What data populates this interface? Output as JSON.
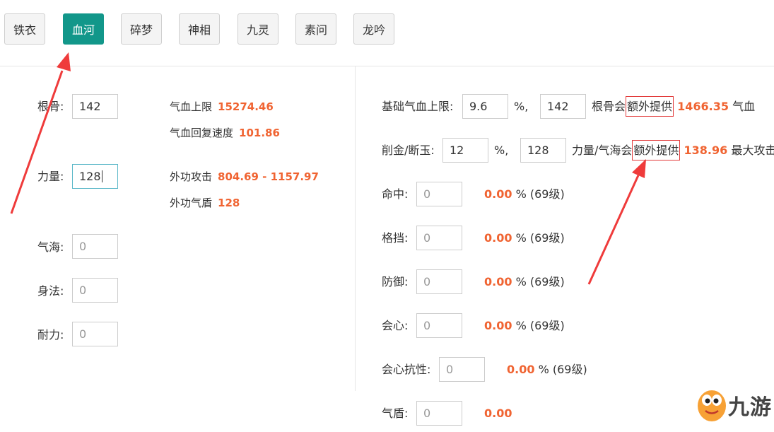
{
  "tabs": [
    "铁衣",
    "血河",
    "碎梦",
    "神相",
    "九灵",
    "素问",
    "龙吟"
  ],
  "active_tab": "血河",
  "attributes": [
    {
      "label": "根骨:",
      "value": "142",
      "placeholder": ""
    },
    {
      "label": "力量:",
      "value": "128",
      "placeholder": ""
    },
    {
      "label": "气海:",
      "value": "",
      "placeholder": "0"
    },
    {
      "label": "身法:",
      "value": "",
      "placeholder": "0"
    },
    {
      "label": "耐力:",
      "value": "",
      "placeholder": "0"
    }
  ],
  "stats": [
    {
      "label": "气血上限",
      "value": "15274.46"
    },
    {
      "label": "气血回复速度",
      "value": "101.86"
    },
    {
      "label": "外功攻击",
      "value": "804.69 - 1157.97"
    },
    {
      "label": "外功气盾",
      "value": "128"
    }
  ],
  "bonus": [
    {
      "label": "基础气血上限:",
      "pct": "9.6",
      "percent_sign": "%,",
      "base": "142",
      "text_before": "根骨会",
      "highlight": "额外提供",
      "value": "1466.35",
      "suffix": "气血"
    },
    {
      "label": "削金/断玉:",
      "pct": "12",
      "percent_sign": "%,",
      "base": "128",
      "text_before": "力量/气海会",
      "highlight": "额外提供",
      "value": "138.96",
      "suffix": "最大攻击"
    }
  ],
  "secondary": [
    {
      "label": "命中:",
      "placeholder": "0",
      "value": "0.00",
      "unit": "%",
      "note": "(69级)"
    },
    {
      "label": "格挡:",
      "placeholder": "0",
      "value": "0.00",
      "unit": "%",
      "note": "(69级)"
    },
    {
      "label": "防御:",
      "placeholder": "0",
      "value": "0.00",
      "unit": "%",
      "note": "(69级)"
    },
    {
      "label": "会心:",
      "placeholder": "0",
      "value": "0.00",
      "unit": "%",
      "note": "(69级)"
    },
    {
      "label": "会心抗性:",
      "placeholder": "0",
      "value": "0.00",
      "unit": "%",
      "note": "(69级)"
    },
    {
      "label": "气盾:",
      "placeholder": "0",
      "value": "0.00",
      "unit": "",
      "note": ""
    }
  ],
  "watermark": "九游",
  "colors": {
    "accent": "#12978a",
    "value": "#f06432",
    "annotation": "#e23a3a"
  }
}
